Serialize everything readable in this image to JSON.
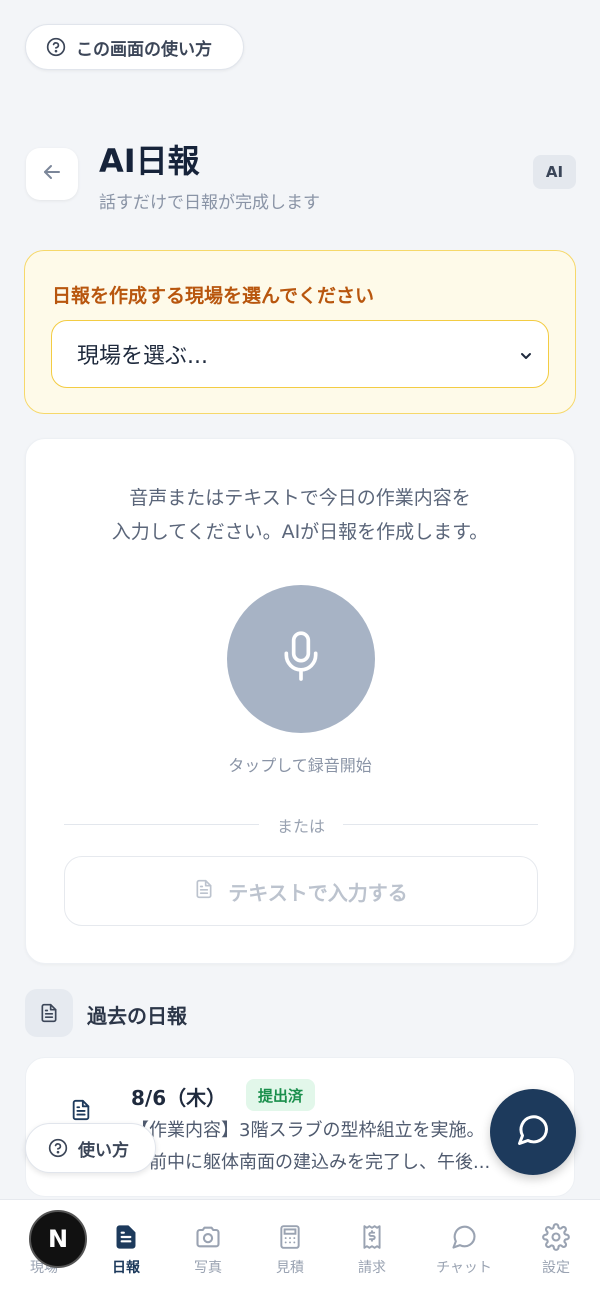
{
  "header": {
    "howto_label": "この画面の使い方",
    "title": "AI日報",
    "subtitle": "話すだけで日報が完成します",
    "badge": "AI"
  },
  "site": {
    "prompt": "日報を作成する現場を選んでください",
    "selected": "現場を選ぶ..."
  },
  "input": {
    "instruction_line1": "音声またはテキストで今日の作業内容を",
    "instruction_line2": "入力してください。AIが日報を作成します。",
    "tap_label": "タップして録音開始",
    "or_label": "または",
    "text_button_label": "テキストで入力する"
  },
  "past": {
    "title": "過去の日報",
    "reports": [
      {
        "date": "8/6（木）",
        "status": "提出済",
        "line1": "【作業内容】3階スラブの型枠組立を実施。",
        "line2": "午前中に躯体南面の建込みを完了し、午後..."
      }
    ]
  },
  "floating": {
    "howto_label": "使い方"
  },
  "nav": {
    "items": [
      {
        "label": "現場",
        "icon": "home-icon"
      },
      {
        "label": "日報",
        "icon": "document-icon"
      },
      {
        "label": "写真",
        "icon": "camera-icon"
      },
      {
        "label": "見積",
        "icon": "calculator-icon"
      },
      {
        "label": "請求",
        "icon": "receipt-icon"
      },
      {
        "label": "チャット",
        "icon": "chat-icon"
      },
      {
        "label": "設定",
        "icon": "gear-icon"
      }
    ],
    "active_index": 1,
    "avatar_letter": "N"
  },
  "colors": {
    "brand": "#1d3a5c",
    "warning_panel": "#fefae9",
    "warning_text": "#b8560e",
    "status_green": "#1a8f4c",
    "mic_disabled": "#a7b3c5"
  }
}
